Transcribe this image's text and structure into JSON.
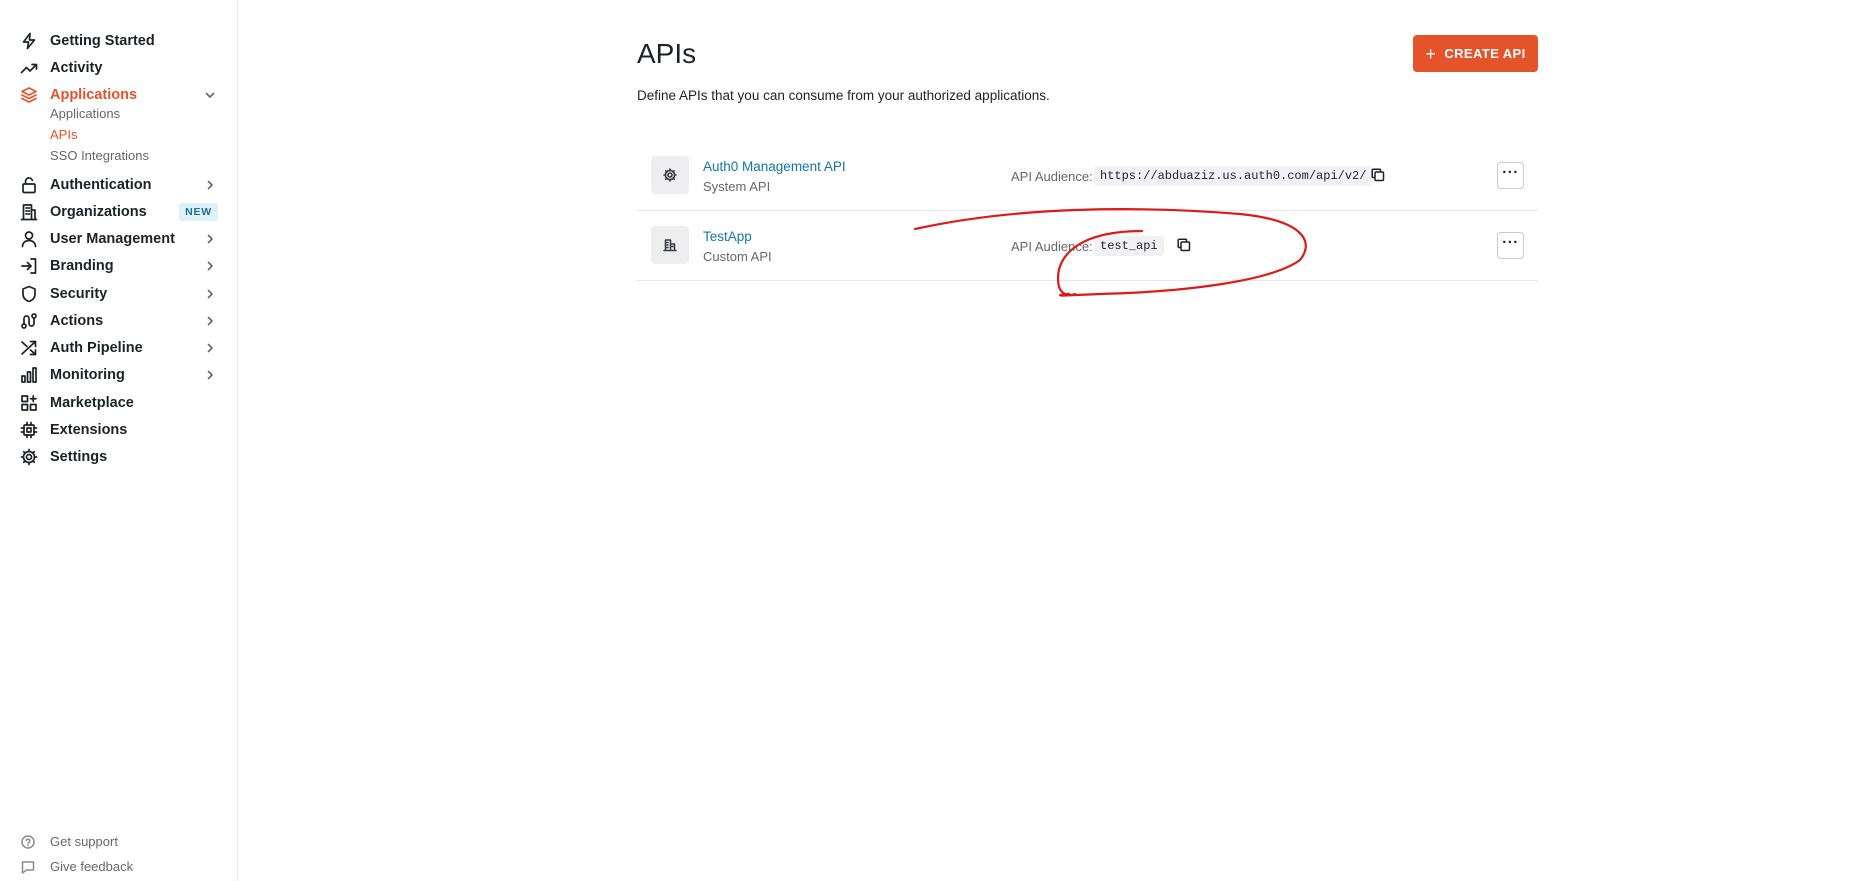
{
  "sidebar": {
    "nav": [
      {
        "label": "Getting Started",
        "icon": "lightning-icon"
      },
      {
        "label": "Activity",
        "icon": "trend-icon"
      },
      {
        "label": "Applications",
        "icon": "layers-icon"
      },
      {
        "label": "Authentication",
        "icon": "lock-icon"
      },
      {
        "label": "Organizations",
        "icon": "building-icon",
        "badge": "NEW"
      },
      {
        "label": "User Management",
        "icon": "user-icon"
      },
      {
        "label": "Branding",
        "icon": "login-icon"
      },
      {
        "label": "Security",
        "icon": "shield-icon"
      },
      {
        "label": "Actions",
        "icon": "actions-icon"
      },
      {
        "label": "Auth Pipeline",
        "icon": "shuffle-icon"
      },
      {
        "label": "Monitoring",
        "icon": "bar-chart-icon"
      },
      {
        "label": "Marketplace",
        "icon": "grid-plus-icon"
      },
      {
        "label": "Extensions",
        "icon": "chip-icon"
      },
      {
        "label": "Settings",
        "icon": "gear-icon"
      }
    ],
    "sub": [
      {
        "label": "Applications"
      },
      {
        "label": "APIs"
      },
      {
        "label": "SSO Integrations"
      }
    ],
    "footer": [
      {
        "label": "Get support",
        "icon": "help-icon"
      },
      {
        "label": "Give feedback",
        "icon": "chat-icon"
      }
    ]
  },
  "main": {
    "title": "APIs",
    "description": "Define APIs that you can consume from your authorized applications.",
    "create_button": {
      "plus": "+",
      "label": "CREATE API"
    },
    "apis": [
      {
        "name": "Auth0 Management API",
        "type": "System API",
        "audience_label": "API Audience:",
        "audience": "https://abduaziz.us.auth0.com/api/v2/",
        "icon": "gear-icon",
        "more": "···"
      },
      {
        "name": "TestApp",
        "type": "Custom API",
        "audience_label": "API Audience:",
        "audience": "test_api",
        "icon": "building-icon",
        "more": "···"
      }
    ]
  },
  "colors": {
    "accent": "#e5532b",
    "link": "#1477a8",
    "annotation": "#e01818"
  }
}
